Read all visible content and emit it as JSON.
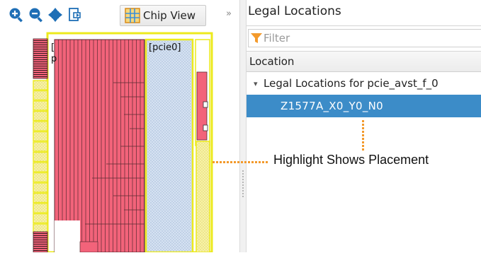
{
  "toolbar": {
    "zoom_in_icon": "zoom-in-icon",
    "zoom_out_icon": "zoom-out-icon",
    "pan_icon": "pan-icon",
    "fit_icon": "fit-to-view-icon",
    "chip_view_label": "Chip View",
    "collapse_glyph": "»"
  },
  "chip_view": {
    "labels": [
      "[",
      "[pcie0]",
      "p"
    ],
    "colors": {
      "logic": "#f2637a",
      "pcie_region": "#c2d4ea",
      "io_border": "#ecea1c",
      "io_fill": "#f7f2a8"
    }
  },
  "panel": {
    "title": "Legal Locations",
    "filter_placeholder": "Filter",
    "column_header": "Location",
    "tree": {
      "parent_label": "Legal Locations for pcie_avst_f_0",
      "child_label": "Z1577A_X0_Y0_N0"
    },
    "selection_color": "#3c8cc8"
  },
  "annotation": {
    "text": "Highlight Shows Placement",
    "color": "#f39a2c"
  }
}
